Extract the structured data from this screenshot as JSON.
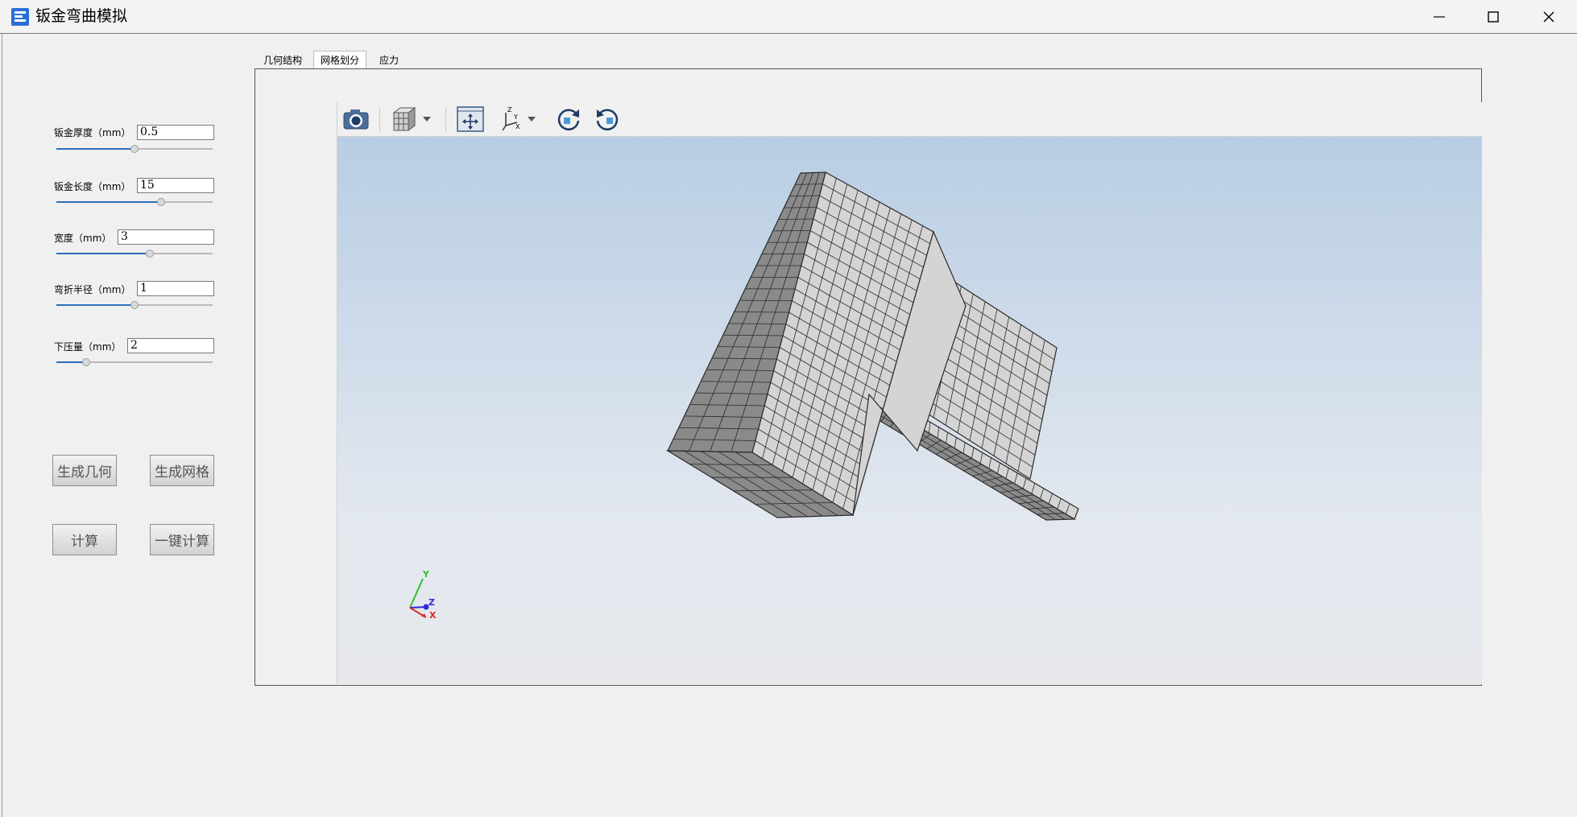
{
  "window": {
    "title": "钣金弯曲模拟"
  },
  "params": [
    {
      "label": "钣金厚度（mm）",
      "value": "0.5",
      "slider": 0.5
    },
    {
      "label": "钣金长度（mm）",
      "value": "15",
      "slider": 0.67
    },
    {
      "label": "宽度（mm）",
      "value": "3",
      "slider": 0.6
    },
    {
      "label": "弯折半径（mm）",
      "value": "1",
      "slider": 0.5
    },
    {
      "label": "下压量（mm）",
      "value": "2",
      "slider": 0.19
    }
  ],
  "buttons": {
    "gen_geometry": "生成几何",
    "gen_mesh": "生成网格",
    "compute": "计算",
    "one_click": "一键计算"
  },
  "tabs": [
    "几何结构",
    "网格划分",
    "应力"
  ],
  "active_tab": 1,
  "toolbar": {
    "icons": [
      "camera-icon",
      "view-cube-icon",
      "fit-all-icon",
      "axis-orientation-icon",
      "rotate-cw-icon",
      "rotate-ccw-icon"
    ]
  },
  "triad": {
    "x": "X",
    "y": "Y",
    "z": "Z"
  },
  "colors": {
    "accent": "#2a6fb8",
    "viewer_top": "#b8cde4",
    "viewer_bottom": "#e6e8ec",
    "mesh_face": "#d4d4d4",
    "mesh_side": "#8a8a8a",
    "mesh_line": "#2a2a2a"
  }
}
